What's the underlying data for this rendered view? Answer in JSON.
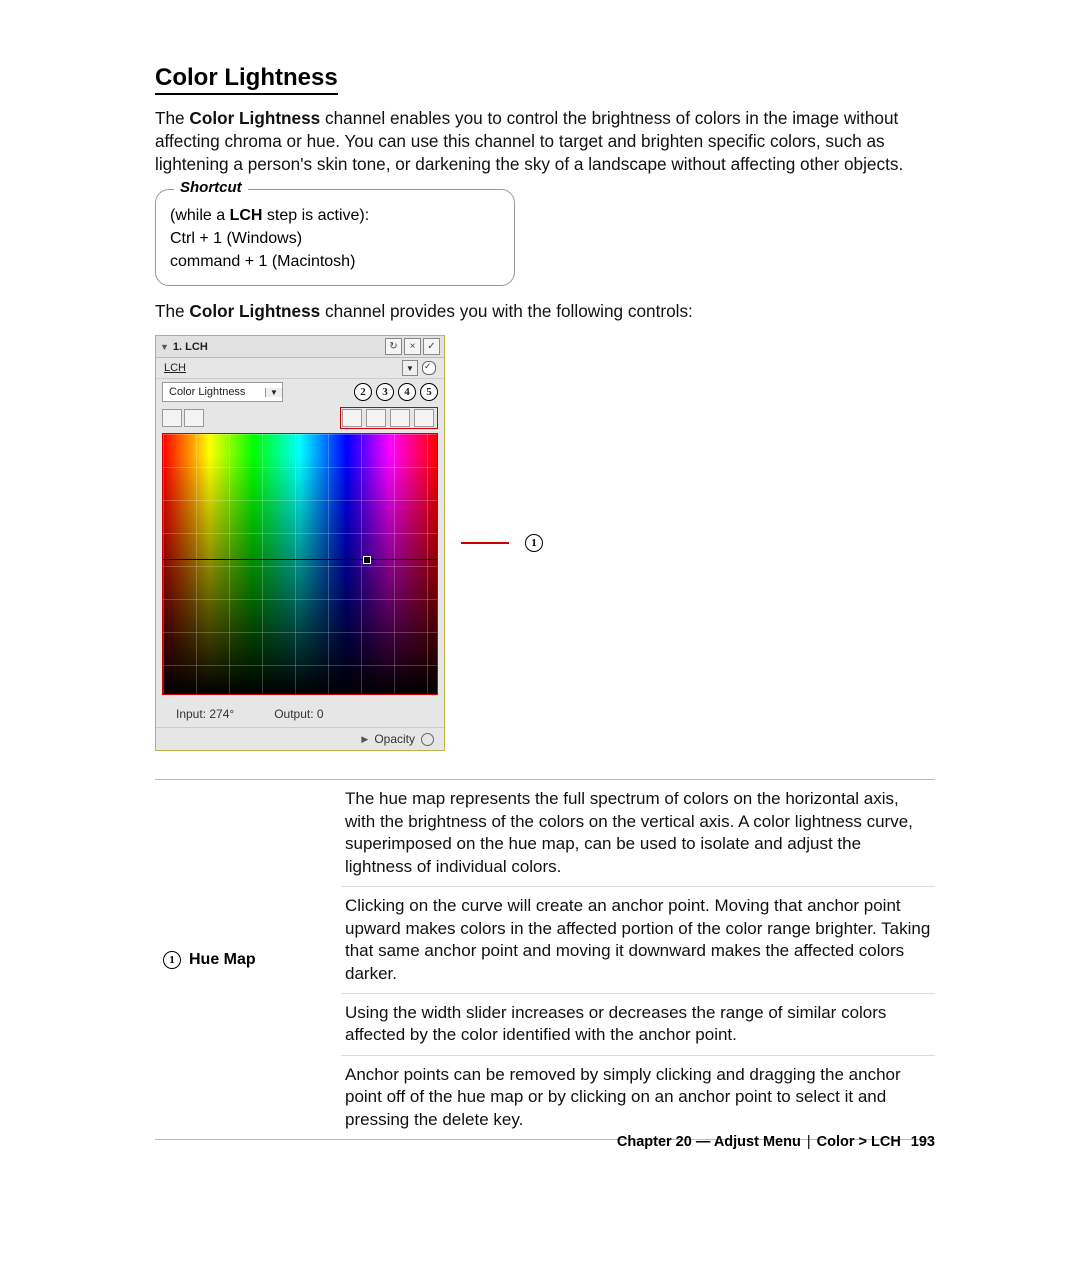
{
  "heading": "Color Lightness",
  "intro_pre": "The ",
  "intro_bold": "Color Lightness",
  "intro_post": " channel enables you to control the brightness of colors in the image without affecting chroma or hue. You can use this channel to target and brighten specific colors, such as lightening a person's skin tone, or darkening the sky of a landscape without affecting other objects.",
  "shortcut": {
    "legend": "Shortcut",
    "l1a": "(while a ",
    "l1b": "LCH",
    "l1c": " step is active):",
    "l2": "Ctrl + 1 (Windows)",
    "l3": "command + 1 (Macintosh)"
  },
  "lead2_pre": "The ",
  "lead2_bold": "Color Lightness",
  "lead2_post": " channel provides you with the following controls:",
  "panel": {
    "title": "1. LCH",
    "row2": "LCH",
    "channel": "Color Lightness",
    "callouts": [
      "2",
      "3",
      "4",
      "5"
    ],
    "input_label": "Input:",
    "input_val": "274°",
    "output_label": "Output:",
    "output_val": "0",
    "opacity": "Opacity"
  },
  "pointer1": "1",
  "table": {
    "num": "1",
    "label": "Hue Map",
    "p1": "The hue map represents the full spectrum of colors on the horizontal axis, with the brightness of the colors on the vertical axis. A color lightness curve, superimposed on the hue map, can be used to isolate and adjust the lightness of individual colors.",
    "p2": "Clicking on the curve will create an anchor point. Moving that anchor point upward makes colors in the affected portion of the color range brighter. Taking that same anchor point and moving it downward makes the affected colors darker.",
    "p3": "Using the width slider increases or decreases the range of similar colors affected by the color identified with the anchor point.",
    "p4": "Anchor points can be removed by simply clicking and dragging the anchor point off of the hue map or by clicking on an anchor point to select it and pressing the delete key."
  },
  "footer": {
    "chapter": "Chapter 20 — Adjust Menu",
    "crumb": "Color > LCH",
    "page": "193"
  }
}
